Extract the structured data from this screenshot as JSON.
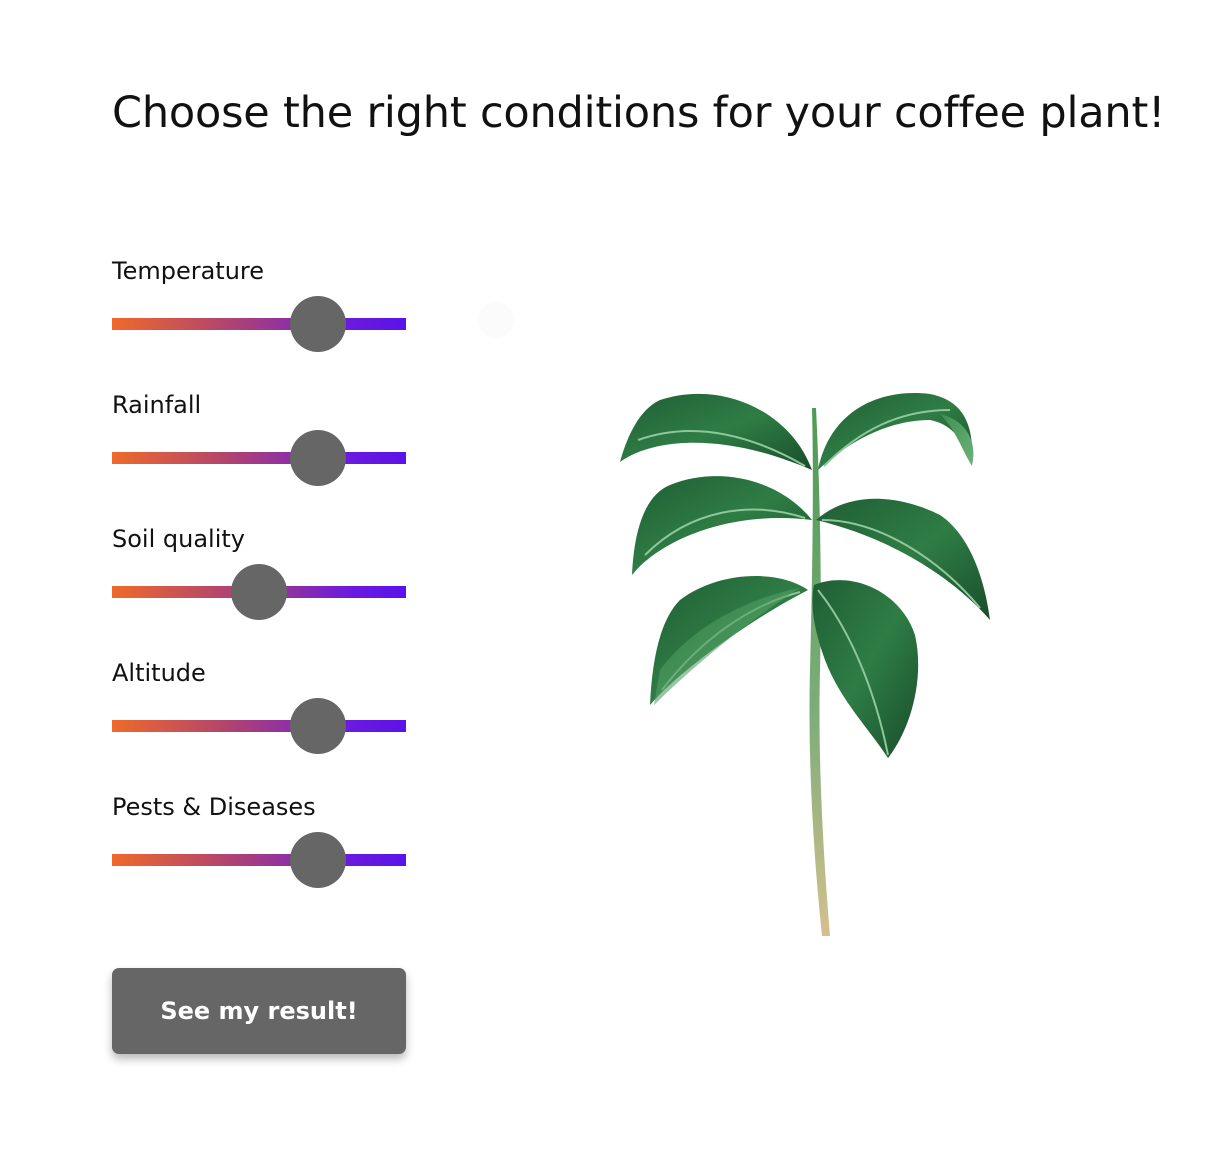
{
  "page": {
    "title": "Choose the right conditions for your coffee plant!"
  },
  "sliders": [
    {
      "label": "Temperature",
      "value": 0.7
    },
    {
      "label": "Rainfall",
      "value": 0.7
    },
    {
      "label": "Soil quality",
      "value": 0.5
    },
    {
      "label": "Altitude",
      "value": 0.7
    },
    {
      "label": "Pests & Diseases",
      "value": 0.7
    }
  ],
  "button": {
    "label": "See my result!"
  },
  "colors": {
    "track_start": "#ee6a2a",
    "track_mid": "#b04371",
    "track_end": "#5b12e8",
    "thumb": "#666666",
    "button_bg": "#666666",
    "button_text": "#ffffff"
  },
  "image": {
    "icon": "coffee-plant-illustration"
  }
}
